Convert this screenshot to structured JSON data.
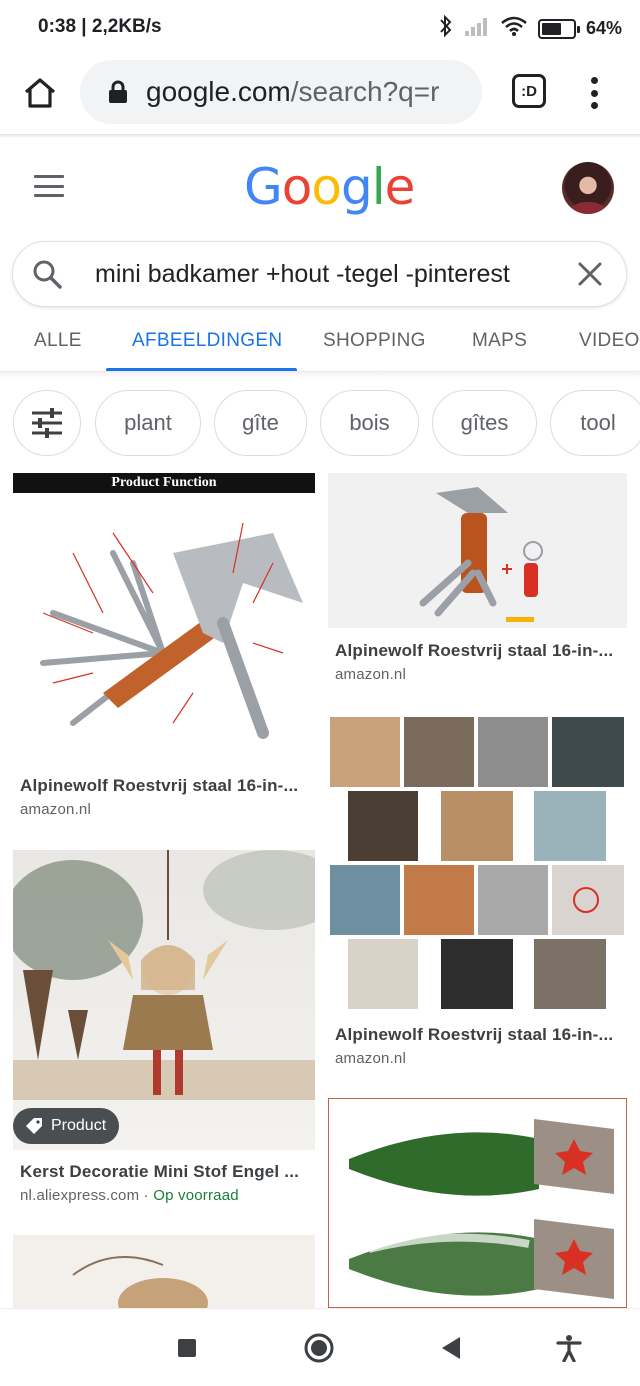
{
  "status_bar": {
    "time_speed": "0:38 | 2,2KB/s",
    "battery": "64%",
    "battery_level": 0.64
  },
  "browser": {
    "url_domain": "google.com",
    "url_path": "/search?q=r",
    "tabs_label": ":D"
  },
  "search": {
    "query": "mini badkamer +hout -tegel -pinterest"
  },
  "tabs": [
    {
      "label": "ALLE",
      "active": false
    },
    {
      "label": "AFBEELDINGEN",
      "active": true
    },
    {
      "label": "SHOPPING",
      "active": false
    },
    {
      "label": "MAPS",
      "active": false
    },
    {
      "label": "VIDEO'S",
      "active": false
    }
  ],
  "chips": [
    "plant",
    "gîte",
    "bois",
    "gîtes",
    "tool"
  ],
  "results": [
    {
      "title": "Alpinewolf Roestvrij staal 16-in-...",
      "source": "amazon.nl",
      "image_heading": "Product Function"
    },
    {
      "title": "Alpinewolf Roestvrij staal 16-in-...",
      "source": "amazon.nl"
    },
    {
      "title": "Alpinewolf Roestvrij staal 16-in-...",
      "source": "amazon.nl"
    },
    {
      "title": "Kerst Decoratie Mini Stof Engel ...",
      "source": "nl.aliexpress.com",
      "stock": "· Op voorraad",
      "badge": "Product"
    }
  ],
  "colors": {
    "accent": "#1a73e8",
    "logo_blue": "#4285f4",
    "logo_red": "#ea4335",
    "logo_yellow": "#fbbc05",
    "logo_green": "#34a853",
    "in_stock": "#188038"
  },
  "logo": [
    "G",
    "o",
    "o",
    "g",
    "l",
    "e"
  ]
}
